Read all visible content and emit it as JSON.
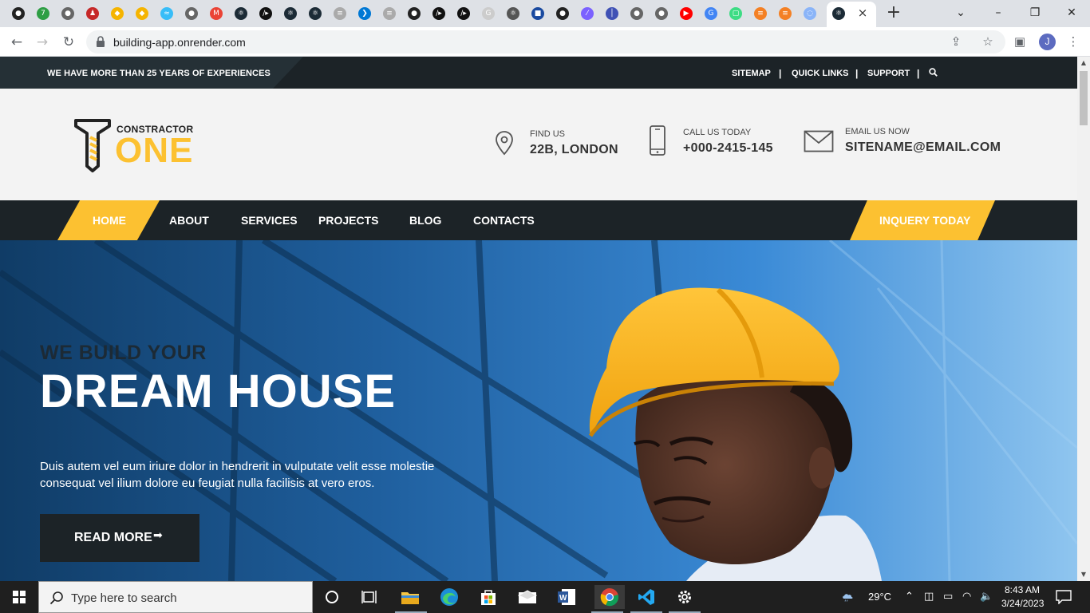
{
  "browser": {
    "tab_favicons": [
      {
        "icon": "node-icon",
        "color": "#222",
        "glyph": "●"
      },
      {
        "icon": "seven-icon",
        "color": "#2e9e44",
        "glyph": "7"
      },
      {
        "icon": "globe-icon",
        "color": "#666",
        "glyph": "●"
      },
      {
        "icon": "figure-icon",
        "color": "#c62828",
        "glyph": "♟"
      },
      {
        "icon": "cube-icon",
        "color": "#f5b400",
        "glyph": "◆"
      },
      {
        "icon": "cube-icon",
        "color": "#f5b400",
        "glyph": "◆"
      },
      {
        "icon": "tailwind-icon",
        "color": "#38bdf8",
        "glyph": "≈"
      },
      {
        "icon": "globe-icon",
        "color": "#666",
        "glyph": "●"
      },
      {
        "icon": "gmail-icon",
        "color": "#ea4335",
        "glyph": "M"
      },
      {
        "icon": "react-icon",
        "color": "#1c2b36",
        "glyph": "⚛"
      },
      {
        "icon": "code-icon",
        "color": "#111",
        "glyph": "/▸"
      },
      {
        "icon": "react-icon",
        "color": "#1c2b36",
        "glyph": "⚛"
      },
      {
        "icon": "react-icon",
        "color": "#1c2b36",
        "glyph": "⚛"
      },
      {
        "icon": "stackoverflow-icon",
        "color": "#aaa",
        "glyph": "≡"
      },
      {
        "icon": "vscode-icon",
        "color": "#0078d4",
        "glyph": "❯"
      },
      {
        "icon": "stackoverflow-icon",
        "color": "#aaa",
        "glyph": "≡"
      },
      {
        "icon": "github-icon",
        "color": "#222",
        "glyph": "●"
      },
      {
        "icon": "code-icon",
        "color": "#111",
        "glyph": "/▸"
      },
      {
        "icon": "code-icon",
        "color": "#111",
        "glyph": "/▸"
      },
      {
        "icon": "google-icon",
        "color": "#ccc",
        "glyph": "G"
      },
      {
        "icon": "react-icon",
        "color": "#555",
        "glyph": "⚛"
      },
      {
        "icon": "app-icon",
        "color": "#1a4aa0",
        "glyph": "■"
      },
      {
        "icon": "github-icon",
        "color": "#222",
        "glyph": "●"
      },
      {
        "icon": "feather-icon",
        "color": "#7b61ff",
        "glyph": "⁄"
      },
      {
        "icon": "pen-icon",
        "color": "#3f51b5",
        "glyph": "│"
      },
      {
        "icon": "globe-icon",
        "color": "#666",
        "glyph": "●"
      },
      {
        "icon": "globe-icon",
        "color": "#666",
        "glyph": "●"
      },
      {
        "icon": "youtube-icon",
        "color": "#ff0000",
        "glyph": "▶"
      },
      {
        "icon": "google-icon",
        "color": "#4285f4",
        "glyph": "G"
      },
      {
        "icon": "square-icon",
        "color": "#3ddc84",
        "glyph": "▢"
      },
      {
        "icon": "stackoverflow-icon",
        "color": "#f48024",
        "glyph": "≡"
      },
      {
        "icon": "stackoverflow-icon",
        "color": "#f48024",
        "glyph": "≡"
      },
      {
        "icon": "loading-icon",
        "color": "#8ab4f8",
        "glyph": "◌"
      },
      {
        "icon": "globe-icon",
        "color": "#666",
        "glyph": "●"
      },
      {
        "icon": "react-icon",
        "color": "#1c2b36",
        "glyph": "⚛"
      }
    ],
    "active_tab_close": "×",
    "new_tab": "+",
    "url": "building-app.onrender.com",
    "profile_initial": "J"
  },
  "topbar": {
    "tagline": "WE HAVE MORE THAN 25 YEARS OF EXPERIENCES",
    "links": [
      "SITEMAP",
      "QUICK LINKS",
      "SUPPORT"
    ],
    "separator": "|"
  },
  "header": {
    "logo_sub": "CONSTRACTOR",
    "logo_main": "ONE",
    "info": [
      {
        "icon": "location-pin-icon",
        "label": "FIND US",
        "value": "22B, LONDON"
      },
      {
        "icon": "phone-icon",
        "label": "CALL US TODAY",
        "value": "+000-2415-145"
      },
      {
        "icon": "envelope-icon",
        "label": "EMAIL US NOW",
        "value": "SITENAME@EMAIL.COM"
      }
    ]
  },
  "nav": {
    "items": [
      "HOME",
      "ABOUT",
      "SERVICES",
      "PROJECTS",
      "BLOG",
      "CONTACTS"
    ],
    "active": "HOME",
    "cta": "INQUERY TODAY"
  },
  "hero": {
    "kicker": "WE BUILD YOUR",
    "title": "DREAM HOUSE",
    "text": "Duis autem vel eum iriure dolor in hendrerit in vulputate velit esse molestie consequat vel ilium dolore eu feugiat nulla facilisis at vero eros.",
    "button": "READ MORE",
    "button_arrow": "➡"
  },
  "taskbar": {
    "search_placeholder": "Type here to search",
    "temperature": "29°C",
    "time": "8:43 AM",
    "date": "3/24/2023"
  },
  "colors": {
    "accent": "#fcc131",
    "dark": "#1c2327",
    "hero_blue": "#2a6fb0"
  }
}
